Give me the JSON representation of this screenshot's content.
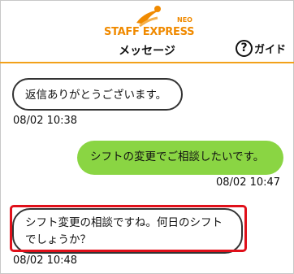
{
  "header": {
    "logo_text": "STAFF EXPRESS",
    "logo_sub": "NEO",
    "title": "メッセージ",
    "guide_label": "ガイド",
    "guide_icon_glyph": "?"
  },
  "messages": [
    {
      "side": "left",
      "text": "返信ありがとうございます。",
      "time": "08/02 10:38"
    },
    {
      "side": "right",
      "text": "シフトの変更でご相談したいです。",
      "time": "08/02 10:47"
    },
    {
      "side": "left",
      "text": "シフト変更の相談ですね。何日のシフトでしょうか？",
      "time": "08/02 10:48",
      "highlighted": true
    }
  ],
  "colors": {
    "accent": "#f2a11a",
    "outgoing_bubble": "#8ad543",
    "highlight": "#e0101a"
  }
}
